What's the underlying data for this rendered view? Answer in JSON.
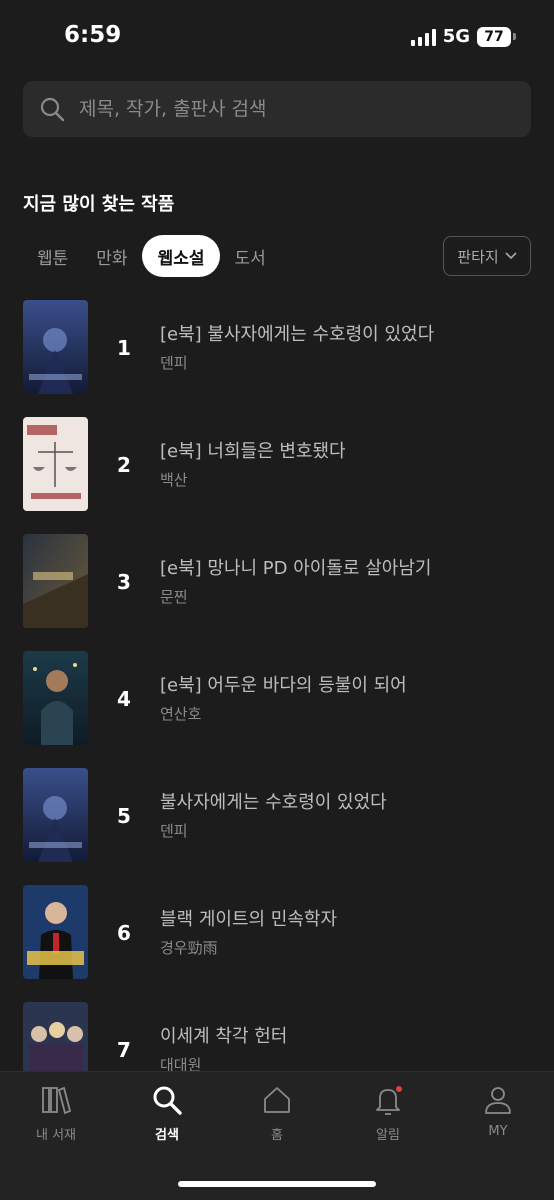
{
  "status": {
    "time": "6:59",
    "network": "5G",
    "battery": "77"
  },
  "search": {
    "placeholder": "제목, 작가, 출판사 검색",
    "icon": "search-icon"
  },
  "section_title": "지금 많이 찾는 작품",
  "tabs": [
    {
      "label": "웹툰"
    },
    {
      "label": "만화"
    },
    {
      "label": "웹소설",
      "active": true
    },
    {
      "label": "도서"
    }
  ],
  "genre_filter": {
    "label": "판타지"
  },
  "books": [
    {
      "rank": "1",
      "title": "[e북] 불사자에게는 수호령이 있었다",
      "author": "덴피"
    },
    {
      "rank": "2",
      "title": "[e북] 너희들은 변호됐다",
      "author": "백산"
    },
    {
      "rank": "3",
      "title": "[e북] 망나니 PD 아이돌로 살아남기",
      "author": "문찐"
    },
    {
      "rank": "4",
      "title": "[e북] 어두운 바다의 등불이 되어",
      "author": "연산호"
    },
    {
      "rank": "5",
      "title": "불사자에게는 수호령이 있었다",
      "author": "덴피"
    },
    {
      "rank": "6",
      "title": "블랙 게이트의 민속학자",
      "author": "경우勁雨"
    },
    {
      "rank": "7",
      "title": "이세계 착각 헌터",
      "author": "대대원"
    }
  ],
  "nav": [
    {
      "label": "내 서재",
      "icon": "library-icon"
    },
    {
      "label": "검색",
      "icon": "search-icon",
      "active": true
    },
    {
      "label": "홈",
      "icon": "home-icon"
    },
    {
      "label": "알림",
      "icon": "bell-icon"
    },
    {
      "label": "MY",
      "icon": "profile-icon"
    }
  ],
  "colors": {
    "background": "#1c1c1c",
    "notification_dot": "#e0403a",
    "active_tab": "#ffffff"
  }
}
